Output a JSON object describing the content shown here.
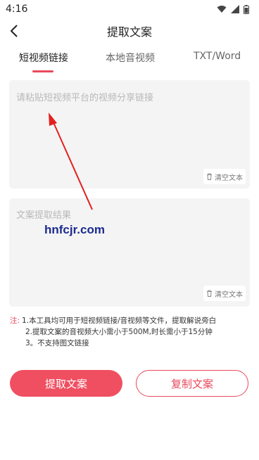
{
  "status_bar": {
    "time": "4:16",
    "icons": [
      "wifi-icon",
      "signal-icon",
      "battery-icon"
    ]
  },
  "header": {
    "title": "提取文案",
    "back_icon": "chevron-left-icon"
  },
  "tabs": [
    {
      "label": "短视频链接",
      "active": true
    },
    {
      "label": "本地音视频",
      "active": false
    },
    {
      "label": "TXT/Word",
      "active": false
    }
  ],
  "input_box": {
    "placeholder": "请粘贴短视频平台的视频分享链接",
    "clear_label": "清空文本"
  },
  "result_box": {
    "placeholder": "文案提取结果",
    "clear_label": "清空文本"
  },
  "watermark": "hnfcjr.com",
  "notes": {
    "label": "注:",
    "lines": [
      "1.本工具均可用于短视频链接/音视频等文件，提取解说旁白",
      "2.提取文案的音视频大小需小于500M,时长需小于15分钟",
      "3。不支持图文链接"
    ]
  },
  "buttons": {
    "extract": "提取文案",
    "copy": "复制文案"
  },
  "colors": {
    "accent": "#ef4f61",
    "watermark": "#1b2a8f",
    "annotation_arrow": "#e32020"
  }
}
